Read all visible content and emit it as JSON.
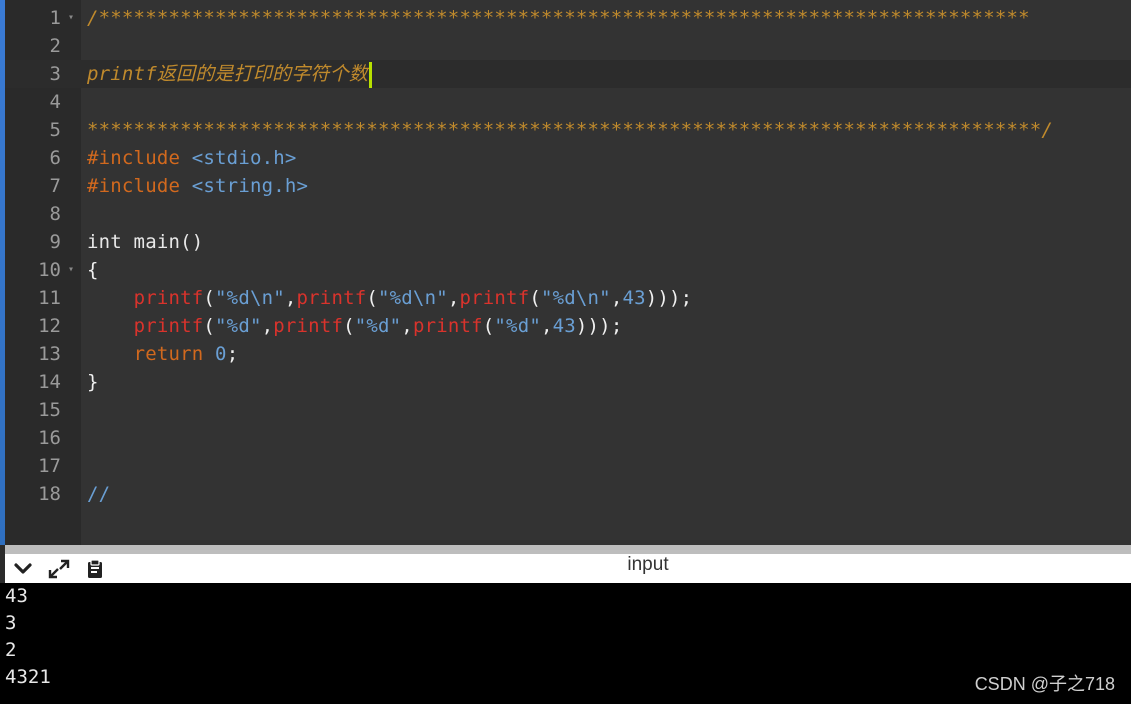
{
  "editor": {
    "lines": [
      {
        "num": "1",
        "fold": "▾",
        "tokens": [
          {
            "t": "/********************************************************************************",
            "c": "c-comment"
          }
        ]
      },
      {
        "num": "2",
        "fold": "",
        "tokens": []
      },
      {
        "num": "3",
        "fold": "",
        "active": true,
        "cursor": true,
        "tokens": [
          {
            "t": "printf返回的是打印的字符个数",
            "c": "c-comment"
          }
        ]
      },
      {
        "num": "4",
        "fold": "",
        "tokens": []
      },
      {
        "num": "5",
        "fold": "",
        "tokens": [
          {
            "t": "**********************************************************************************/",
            "c": "c-comment"
          }
        ]
      },
      {
        "num": "6",
        "fold": "",
        "tokens": [
          {
            "t": "#include ",
            "c": "c-pre"
          },
          {
            "t": "<stdio.h>",
            "c": "c-hdr"
          }
        ]
      },
      {
        "num": "7",
        "fold": "",
        "tokens": [
          {
            "t": "#include ",
            "c": "c-pre"
          },
          {
            "t": "<string.h>",
            "c": "c-hdr"
          }
        ]
      },
      {
        "num": "8",
        "fold": "",
        "tokens": []
      },
      {
        "num": "9",
        "fold": "",
        "tokens": [
          {
            "t": "int main()",
            "c": "c-type"
          }
        ]
      },
      {
        "num": "10",
        "fold": "▾",
        "tokens": [
          {
            "t": "{",
            "c": "c-punc"
          }
        ]
      },
      {
        "num": "11",
        "fold": "",
        "tokens": [
          {
            "t": "    ",
            "c": "c-punc"
          },
          {
            "t": "printf",
            "c": "c-fn"
          },
          {
            "t": "(",
            "c": "c-punc"
          },
          {
            "t": "\"%d\\n\"",
            "c": "c-str"
          },
          {
            "t": ",",
            "c": "c-punc"
          },
          {
            "t": "printf",
            "c": "c-fn"
          },
          {
            "t": "(",
            "c": "c-punc"
          },
          {
            "t": "\"%d\\n\"",
            "c": "c-str"
          },
          {
            "t": ",",
            "c": "c-punc"
          },
          {
            "t": "printf",
            "c": "c-fn"
          },
          {
            "t": "(",
            "c": "c-punc"
          },
          {
            "t": "\"%d\\n\"",
            "c": "c-str"
          },
          {
            "t": ",",
            "c": "c-punc"
          },
          {
            "t": "43",
            "c": "c-num"
          },
          {
            "t": ")));",
            "c": "c-punc"
          }
        ]
      },
      {
        "num": "12",
        "fold": "",
        "tokens": [
          {
            "t": "    ",
            "c": "c-punc"
          },
          {
            "t": "printf",
            "c": "c-fn"
          },
          {
            "t": "(",
            "c": "c-punc"
          },
          {
            "t": "\"%d\"",
            "c": "c-str"
          },
          {
            "t": ",",
            "c": "c-punc"
          },
          {
            "t": "printf",
            "c": "c-fn"
          },
          {
            "t": "(",
            "c": "c-punc"
          },
          {
            "t": "\"%d\"",
            "c": "c-str"
          },
          {
            "t": ",",
            "c": "c-punc"
          },
          {
            "t": "printf",
            "c": "c-fn"
          },
          {
            "t": "(",
            "c": "c-punc"
          },
          {
            "t": "\"%d\"",
            "c": "c-str"
          },
          {
            "t": ",",
            "c": "c-punc"
          },
          {
            "t": "43",
            "c": "c-num"
          },
          {
            "t": ")));",
            "c": "c-punc"
          }
        ]
      },
      {
        "num": "13",
        "fold": "",
        "tokens": [
          {
            "t": "    ",
            "c": "c-punc"
          },
          {
            "t": "return",
            "c": "c-kw"
          },
          {
            "t": " ",
            "c": "c-punc"
          },
          {
            "t": "0",
            "c": "c-num"
          },
          {
            "t": ";",
            "c": "c-punc"
          }
        ]
      },
      {
        "num": "14",
        "fold": "",
        "tokens": [
          {
            "t": "}",
            "c": "c-punc"
          }
        ]
      },
      {
        "num": "15",
        "fold": "",
        "tokens": []
      },
      {
        "num": "16",
        "fold": "",
        "tokens": []
      },
      {
        "num": "17",
        "fold": "",
        "tokens": []
      },
      {
        "num": "18",
        "fold": "",
        "tokens": [
          {
            "t": "//",
            "c": "c-hdr"
          }
        ]
      }
    ]
  },
  "panel": {
    "title": "input",
    "icons": [
      "chevron-down-icon",
      "expand-icon",
      "clipboard-icon"
    ]
  },
  "output": {
    "lines": [
      "43",
      "3",
      "2",
      "4321"
    ]
  },
  "watermark": "CSDN @子之718",
  "colors": {
    "comment": "#c08a2c",
    "function": "#d9332c",
    "string": "#6a9fd4",
    "preprocessor": "#d2691e",
    "cursor": "#b7e000"
  }
}
